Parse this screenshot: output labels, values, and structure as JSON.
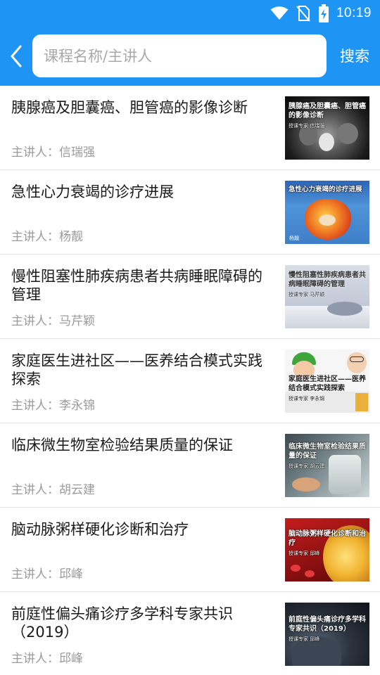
{
  "status_bar": {
    "time": "10:19",
    "icons": [
      "wifi-icon",
      "no-sim-icon",
      "battery-charging-icon"
    ]
  },
  "header": {
    "back_icon": "chevron-left-icon",
    "search_placeholder": "课程名称/主讲人",
    "search_button": "搜索"
  },
  "colors": {
    "primary": "#1E94F5",
    "title_text": "#1a1a1a",
    "lecturer_text": "#9a9a9a",
    "divider": "#e6e6e6"
  },
  "courses": [
    {
      "title": "胰腺癌及胆囊癌、胆管癌的影像诊断",
      "lecturer": "主讲人：信瑞强",
      "thumb_caption": "胰腺癌及胆囊癌、胆管癌的影像诊断",
      "thumb_sub": "授课专家 信瑞强"
    },
    {
      "title": "急性心力衰竭的诊疗进展",
      "lecturer": "主讲人：杨靓",
      "thumb_caption": "急性心力衰竭的诊疗进展",
      "thumb_sub": "杨靓"
    },
    {
      "title": "慢性阻塞性肺疾病患者共病睡眠障碍的管理",
      "lecturer": "主讲人：马芹颖",
      "thumb_caption": "慢性阻塞性肺疾病患者共病睡眠障碍的管理",
      "thumb_sub": "授课专家 马芹颖"
    },
    {
      "title": "家庭医生进社区——医养结合模式实践探索",
      "lecturer": "主讲人：李永锦",
      "thumb_caption": "家庭医生进社区——医养结合模式实践探索",
      "thumb_sub": "授课专家 李永锦"
    },
    {
      "title": "临床微生物室检验结果质量的保证",
      "lecturer": "主讲人：胡云建",
      "thumb_caption": "临床微生物室检验结果质量的保证",
      "thumb_sub": "授课专家 胡云建"
    },
    {
      "title": "脑动脉粥样硬化诊断和治疗",
      "lecturer": "主讲人：邱峰",
      "thumb_caption": "脑动脉粥样硬化诊断和治疗",
      "thumb_sub": "授课专家 邱峰"
    },
    {
      "title": "前庭性偏头痛诊疗多学科专家共识（2019）",
      "lecturer": "主讲人：邱峰",
      "thumb_caption": "前庭性偏头痛诊疗多学科专家共识（2019）",
      "thumb_sub": "授课专家 邱峰"
    }
  ]
}
